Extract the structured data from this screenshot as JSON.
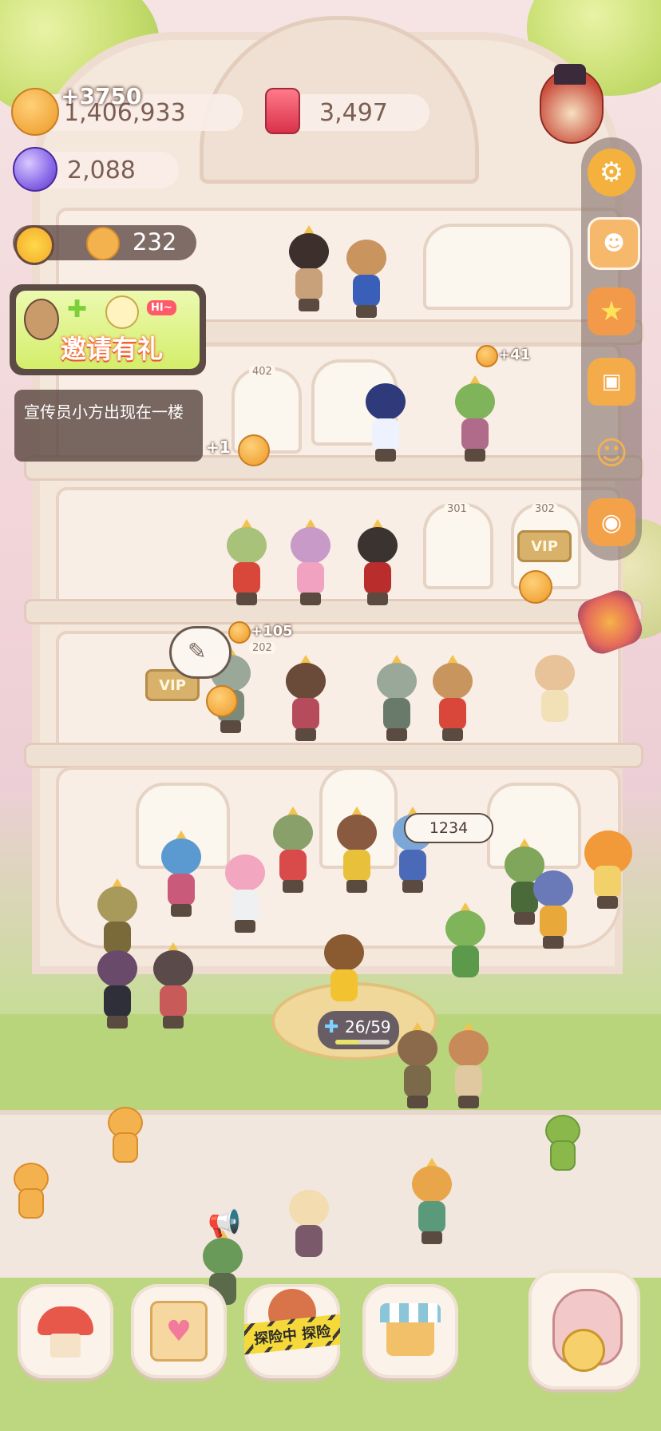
{
  "hud": {
    "coins_value": "1,406,933",
    "coins_gain": "+3750",
    "candles_value": "3,497",
    "gems_value": "2,088",
    "visitors_value": "232"
  },
  "promo": {
    "invite_label": "邀请有礼",
    "hi_badge": "HI~",
    "notice_text": "宣传员小方出现在一楼"
  },
  "building": {
    "room_numbers": [
      "402",
      "301",
      "302",
      "202"
    ],
    "vip_label": "VIP"
  },
  "floating_gains": [
    "+41",
    "+1",
    "+105"
  ],
  "counter_label": "1234",
  "capacity": {
    "current": 26,
    "max": 59,
    "text": "26/59"
  },
  "sidebar": {
    "items": [
      {
        "name": "settings",
        "icon": "gear-icon"
      },
      {
        "name": "poster",
        "icon": "poster-icon"
      },
      {
        "name": "shop",
        "icon": "star-shop-icon"
      },
      {
        "name": "backpack",
        "icon": "backpack-icon"
      },
      {
        "name": "characters",
        "icon": "characters-icon"
      },
      {
        "name": "camera",
        "icon": "camera-icon"
      }
    ]
  },
  "explore_label": "探险中 探险",
  "bottom_nav": [
    {
      "name": "build",
      "icon": "mushroom-house-icon"
    },
    {
      "name": "journal",
      "icon": "heart-notebook-icon"
    },
    {
      "name": "explore",
      "icon": "explore-icon"
    },
    {
      "name": "stall",
      "icon": "stall-icon"
    },
    {
      "name": "pet",
      "icon": "pet-clock-icon"
    }
  ],
  "colors": {
    "accent_green": "#d8f06a",
    "brand_orange": "#f2a93e",
    "invite_text": "#ffffff"
  }
}
